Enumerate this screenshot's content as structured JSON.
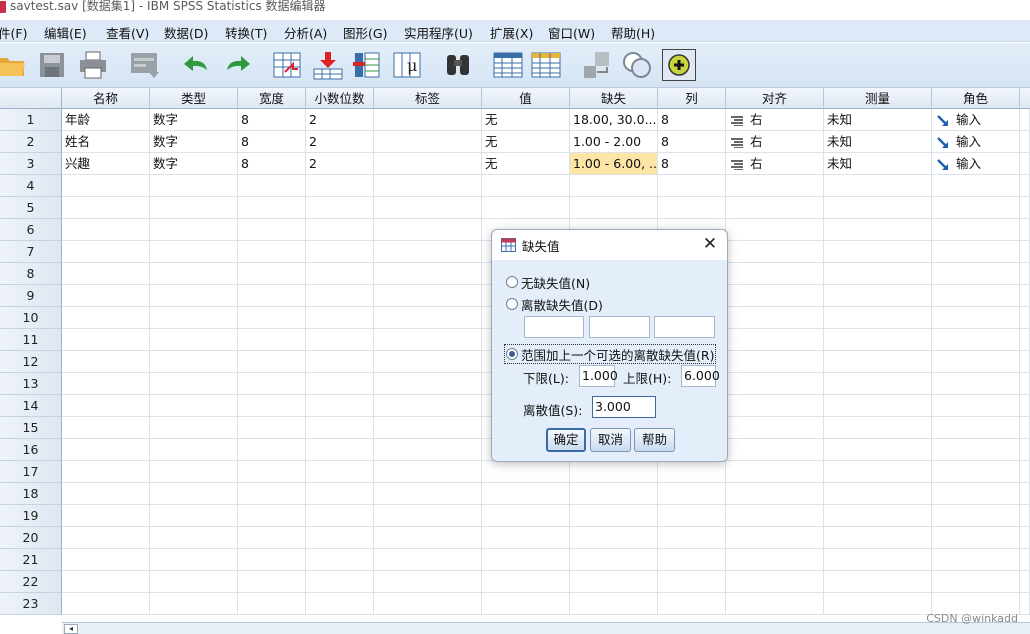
{
  "window": {
    "title": "savtest.sav [数据集1] - IBM SPSS Statistics 数据编辑器"
  },
  "menubar": {
    "items": [
      "件(F)",
      "编辑(E)",
      "查看(V)",
      "数据(D)",
      "转换(T)",
      "分析(A)",
      "图形(G)",
      "实用程序(U)",
      "扩展(X)",
      "窗口(W)",
      "帮助(H)"
    ]
  },
  "toolbar": {
    "icons": [
      "open-folder-icon",
      "save-icon",
      "print-icon",
      "recall-dialog-icon",
      "undo-icon",
      "redo-icon",
      "go-to-case-icon",
      "insert-variable-icon",
      "variables-icon",
      "run-descriptives-icon",
      "find-icon",
      "split-file-icon",
      "select-cases-icon",
      "value-labels-icon",
      "use-variable-sets-icon",
      "add-on-icon"
    ]
  },
  "grid": {
    "columns": [
      "名称",
      "类型",
      "宽度",
      "小数位数",
      "标签",
      "值",
      "缺失",
      "列",
      "对齐",
      "测量",
      "角色"
    ],
    "rows": [
      {
        "num": "1",
        "name": "年龄",
        "type": "数字",
        "width": "8",
        "decimals": "2",
        "label": "",
        "values": "无",
        "missing": "18.00, 30.0...",
        "columns": "8",
        "align": "右",
        "measure": "未知",
        "role": "输入"
      },
      {
        "num": "2",
        "name": "姓名",
        "type": "数字",
        "width": "8",
        "decimals": "2",
        "label": "",
        "values": "无",
        "missing": "1.00 - 2.00",
        "columns": "8",
        "align": "右",
        "measure": "未知",
        "role": "输入"
      },
      {
        "num": "3",
        "name": "兴趣",
        "type": "数字",
        "width": "8",
        "decimals": "2",
        "label": "",
        "values": "无",
        "missing": "1.00 - 6.00, ...",
        "columns": "8",
        "align": "右",
        "measure": "未知",
        "role": "输入"
      }
    ],
    "empty_row_numbers": [
      "4",
      "5",
      "6",
      "7",
      "8",
      "9",
      "10",
      "11",
      "12",
      "13",
      "14",
      "15",
      "16",
      "17",
      "18",
      "19",
      "20",
      "21",
      "22",
      "23"
    ]
  },
  "dialog": {
    "title": "缺失值",
    "option_none": "无缺失值(N)",
    "option_discrete": "离散缺失值(D)",
    "discrete_values": [
      "",
      "",
      ""
    ],
    "option_range": "范围加上一个可选的离散缺失值(R)",
    "selected_option": "range",
    "low_label": "下限(L):",
    "low_value": "1.000",
    "high_label": "上限(H):",
    "high_value": "6.000",
    "discrete_label": "离散值(S):",
    "discrete_value": "3.000",
    "ok_label": "确定",
    "cancel_label": "取消",
    "help_label": "帮助"
  },
  "watermark": "CSDN @winkadd"
}
